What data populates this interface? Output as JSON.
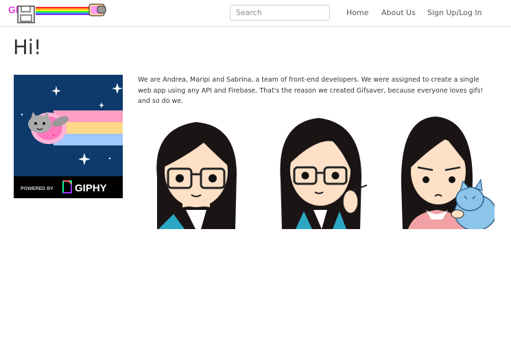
{
  "navbar": {
    "logo_text": "GIF",
    "search_placeholder": "Search",
    "links": [
      {
        "label": "Home"
      },
      {
        "label": "About Us"
      },
      {
        "label": "Sign Up/Log In"
      }
    ]
  },
  "main": {
    "heading": "Hi!",
    "gif_badge": {
      "powered_by": "POWERED BY",
      "brand": "GIPHY"
    },
    "intro_text": "We are Andrea, Maripi and Sabrina, a team of front-end developers. We were assigned to create a single web app using any API and Firebase. That's the reason we created Gifsaver, because everyone loves gifs! and so do we."
  },
  "colors": {
    "gif_background": "#0d3a6b",
    "nyan_rainbow": [
      "#ff9ec3",
      "#ffd98a",
      "#9ec8ff"
    ],
    "hair": "#1a1414",
    "skin": "#fde0c5",
    "teal": "#2ba7c4",
    "pink": "#f1a1a3",
    "cat_blue": "#8cc4ea"
  }
}
